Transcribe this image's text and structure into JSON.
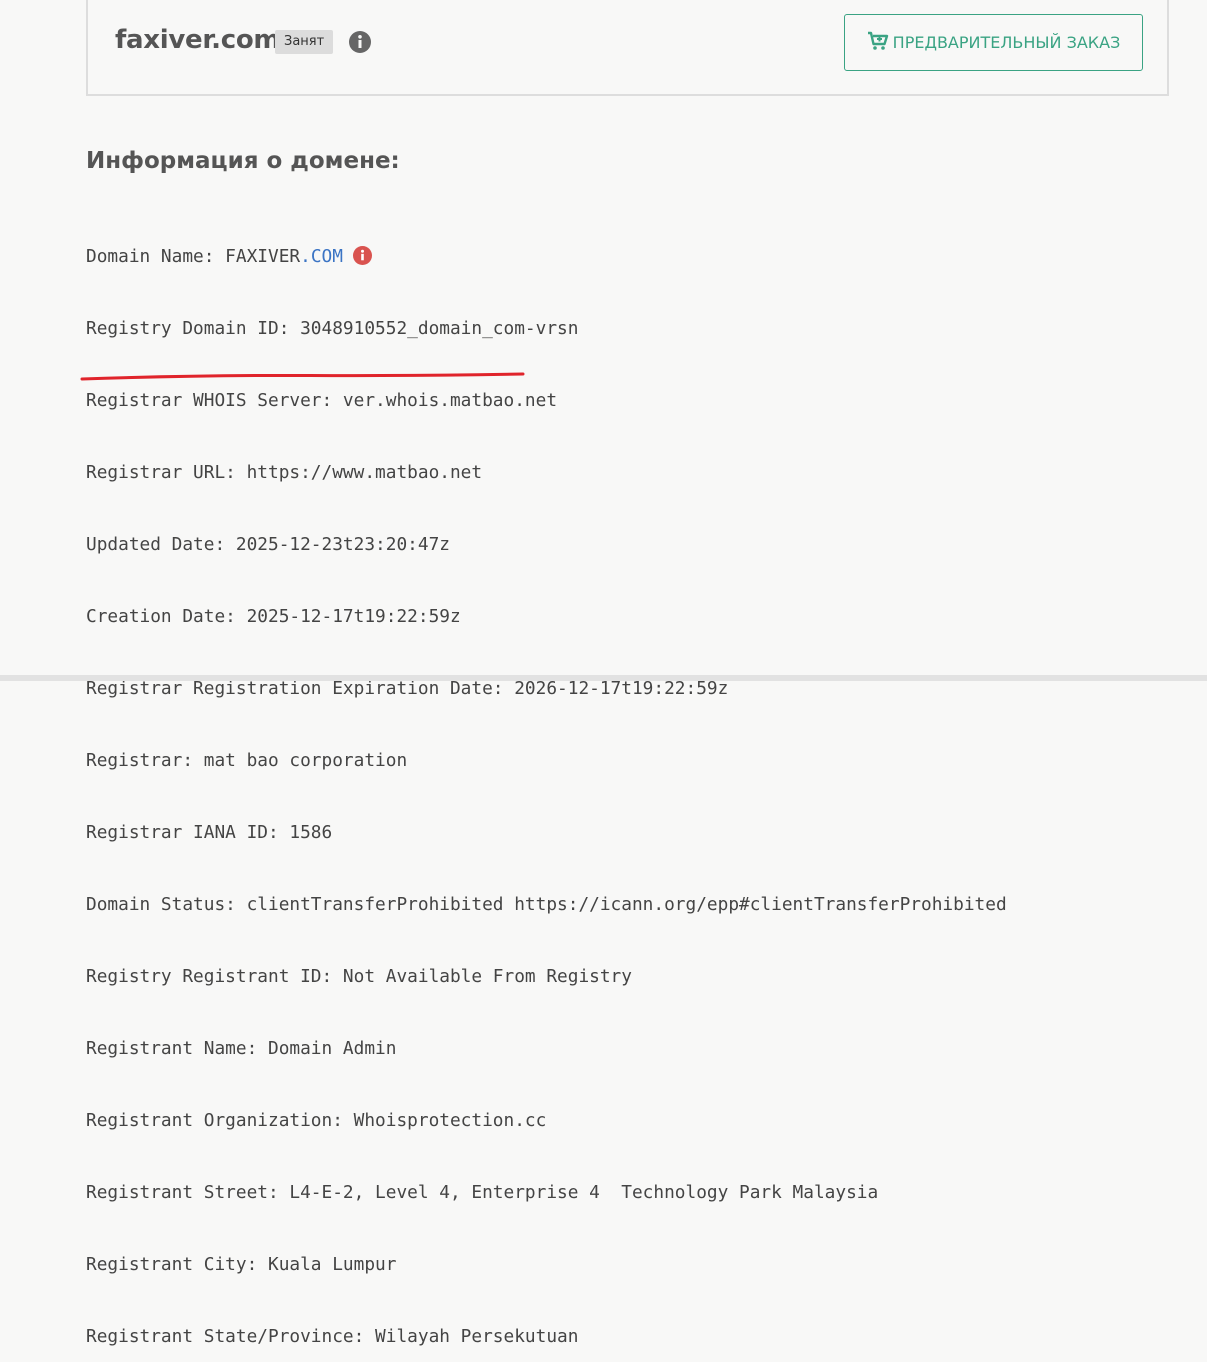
{
  "domain_card": {
    "domain_name": "faxiver.com",
    "status": "Занят",
    "preorder_label": "ПРЕДВАРИТЕЛЬНЫЙ ЗАКАЗ",
    "accent_color": "#3aa383"
  },
  "section": {
    "title": "Информация о домене:"
  },
  "whois": {
    "domain_name_label": "Domain Name: ",
    "domain_name_base": "FAXIVER",
    "domain_name_tld": ".COM",
    "lines": [
      "Registry Domain ID: 3048910552_domain_com-vrsn",
      "Registrar WHOIS Server: ver.whois.matbao.net",
      "Registrar URL: https://www.matbao.net",
      "Updated Date: 2025-12-23t23:20:47z",
      "Creation Date: 2025-12-17t19:22:59z",
      "Registrar Registration Expiration Date: 2026-12-17t19:22:59z",
      "Registrar: mat bao corporation",
      "Registrar IANA ID: 1586",
      "Domain Status: clientTransferProhibited https://icann.org/epp#clientTransferProhibited",
      "Registry Registrant ID: Not Available From Registry",
      "Registrant Name: Domain Admin",
      "Registrant Organization: Whoisprotection.cc",
      "Registrant Street: L4-E-2, Level 4, Enterprise 4  Technology Park Malaysia",
      "Registrant City: Kuala Lumpur",
      "Registrant State/Province: Wilayah Persekutuan"
    ],
    "tld_color": "#3b74c4",
    "alert_color": "#d9534f",
    "highlight_color": "#e0242b"
  }
}
